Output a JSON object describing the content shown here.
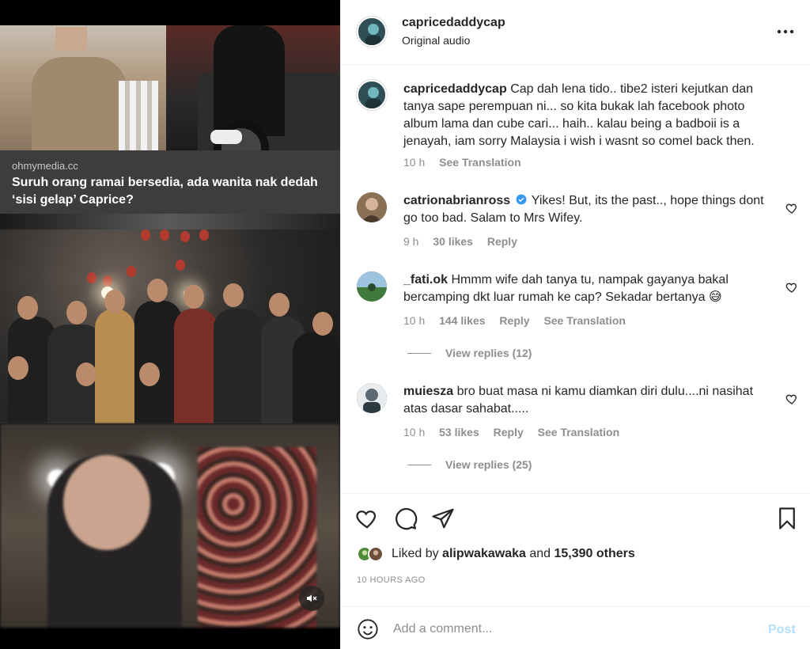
{
  "media": {
    "link_site": "ohmymedia.cc",
    "link_title": "Suruh orang ramai bersedia, ada wanita nak dedah ‘sisi gelap’ Caprice?",
    "mute_icon": "speaker-muted-icon"
  },
  "header": {
    "username": "capricedaddycap",
    "subtitle": "Original audio",
    "more_icon": "more-horizontal-icon"
  },
  "caption": {
    "username": "capricedaddycap",
    "text": "Cap dah lena tido.. tibe2 isteri kejutkan dan tanya sape perempuan ni... so kita bukak lah facebook photo album lama dan cube cari... haih.. kalau being a badboii is a jenayah, iam sorry Malaysia i wish i wasnt so comel back then.",
    "time": "10 h",
    "see_translation": "See Translation"
  },
  "comments": [
    {
      "username": "catrionabrianross",
      "verified": true,
      "text": "Yikes! But, its the past.., hope things dont go too bad. Salam to Mrs Wifey.",
      "time": "9 h",
      "likes": "30 likes",
      "reply": "Reply"
    },
    {
      "username": "_fati.ok",
      "text": "Hmmm wife dah tanya tu, nampak gayanya bakal bercamping dkt luar rumah ke cap? Sekadar bertanya 😅",
      "time": "10 h",
      "likes": "144 likes",
      "reply": "Reply",
      "see_translation": "See Translation",
      "view_replies": "View replies (12)"
    },
    {
      "username": "muiesza",
      "text": "bro buat masa ni kamu diamkan diri dulu....ni nasihat atas dasar sahabat.....",
      "time": "10 h",
      "likes": "53 likes",
      "reply": "Reply",
      "see_translation": "See Translation",
      "view_replies": "View replies (25)"
    }
  ],
  "actions": {
    "liked_prefix": "Liked by",
    "liked_user": "alipwakawaka",
    "liked_and": "and",
    "liked_others": "15,390 others",
    "timestamp": "10 HOURS AGO"
  },
  "add_comment": {
    "placeholder": "Add a comment...",
    "post_label": "Post"
  },
  "colors": {
    "verified": "#3897f0",
    "post_disabled": "#b2dffc",
    "muted_text": "#8e8e8e"
  }
}
